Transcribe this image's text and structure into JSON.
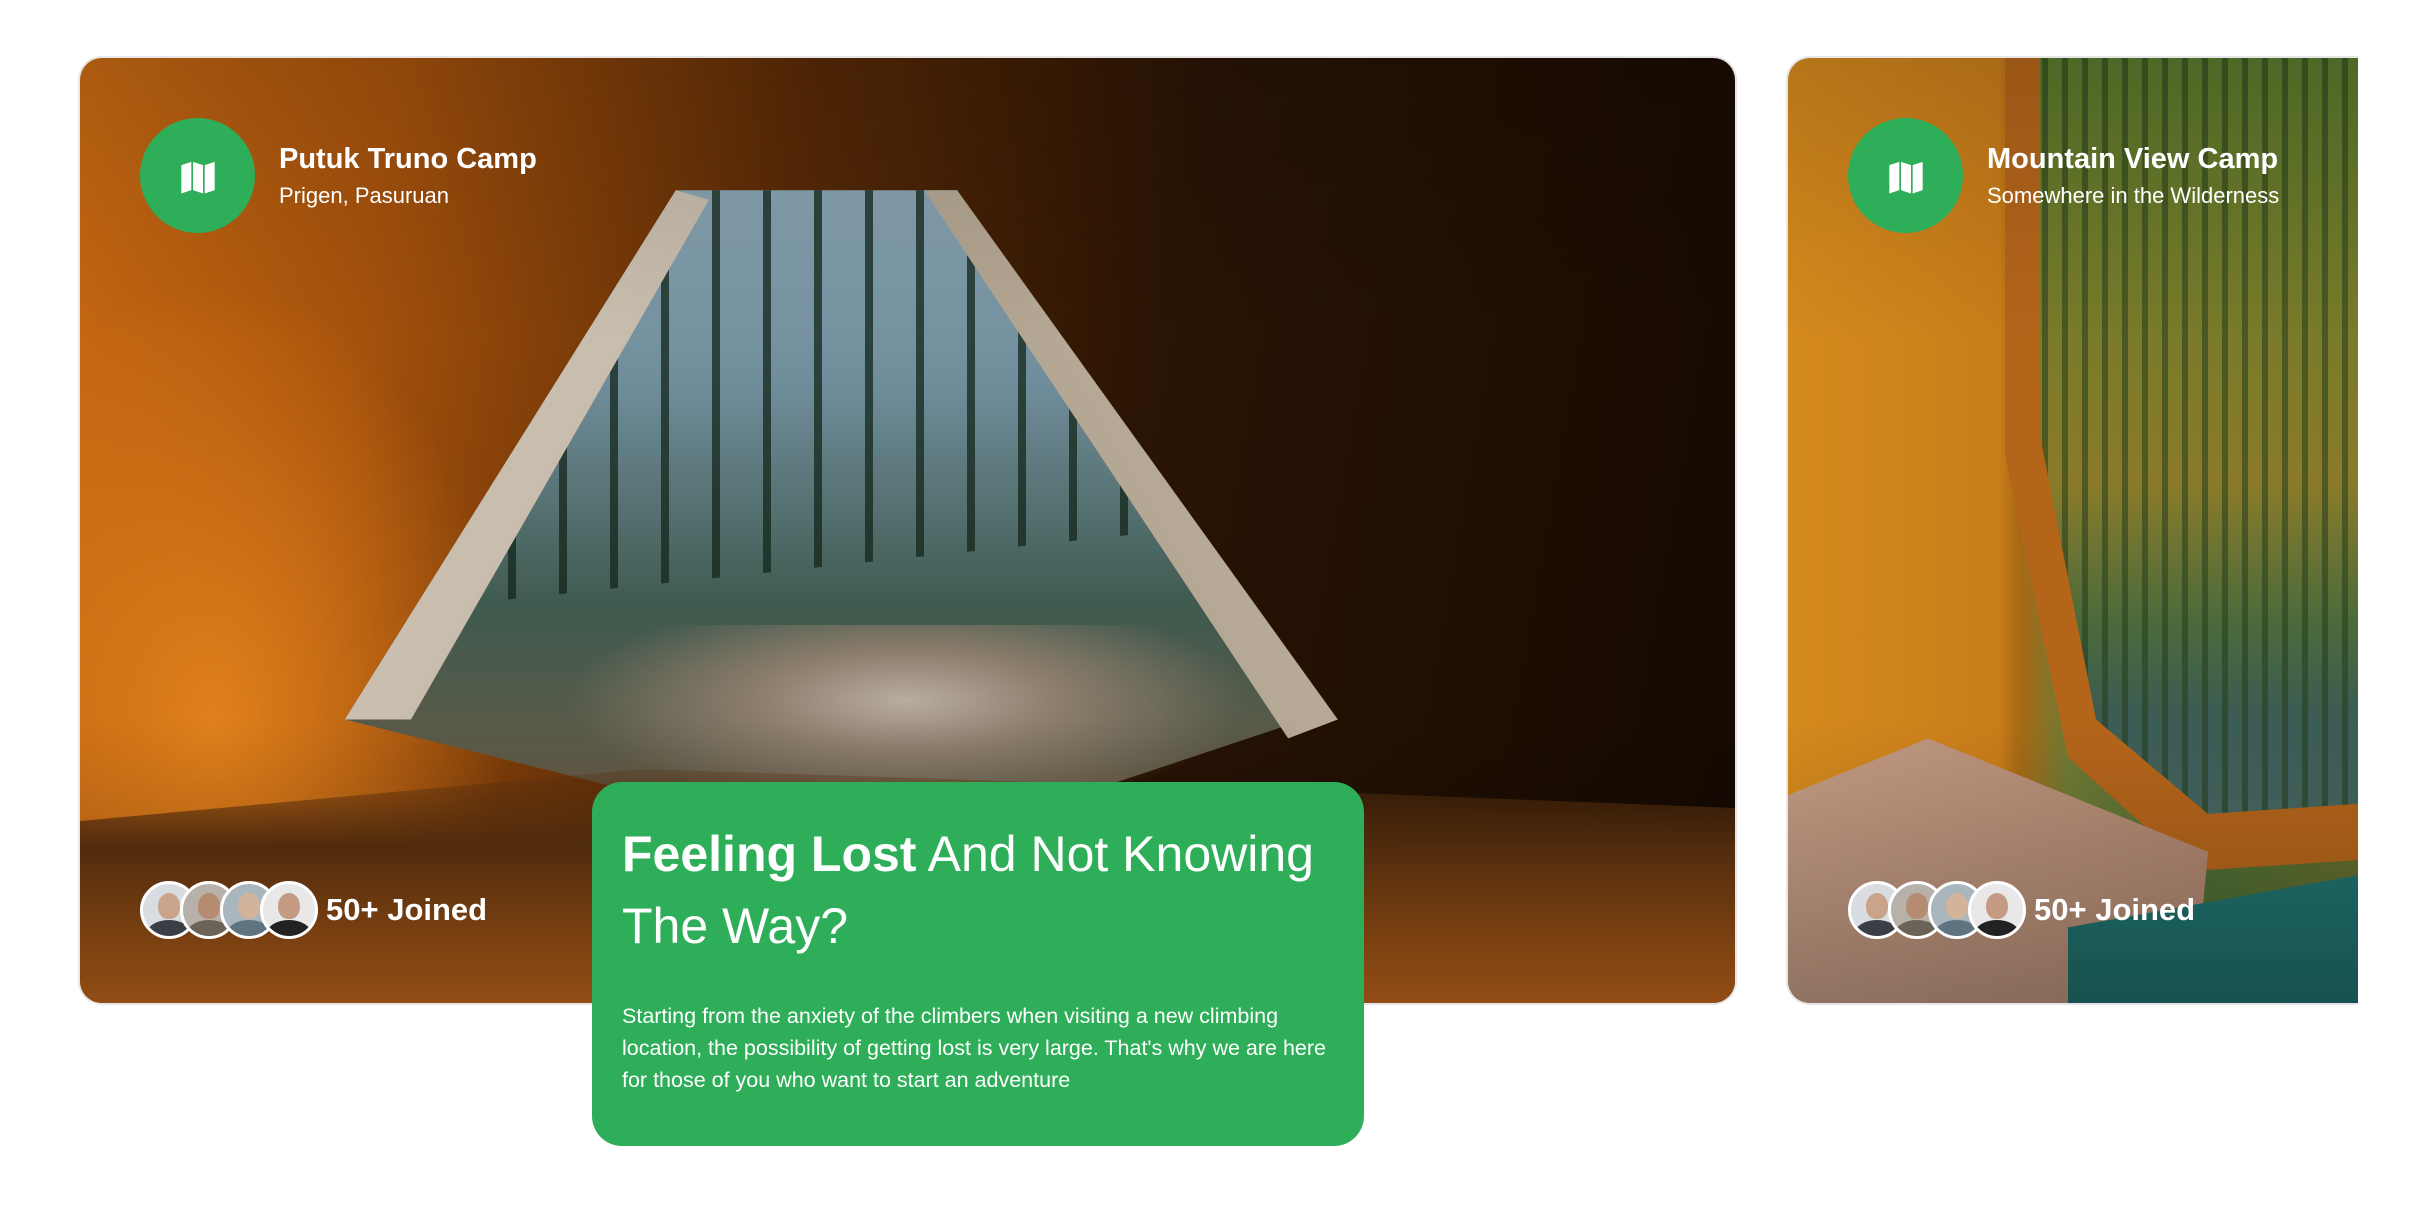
{
  "cards": [
    {
      "title": "Putuk Truno Camp",
      "location": "Prigen, Pasuruan",
      "joined": "50+ Joined",
      "icon": "map-icon"
    },
    {
      "title": "Mountain View Camp",
      "location": "Somewhere in the Wilderness",
      "joined": "50+ Joined",
      "icon": "map-icon"
    }
  ],
  "info": {
    "title_bold": "Feeling Lost",
    "title_rest": " And Not Knowing The Way?",
    "body": "Starting from the anxiety of the climbers when visiting a new climbing location, the possibility of getting lost is very large. That's why we are here for those of you who want to start an adventure"
  },
  "colors": {
    "accent": "#2eae58",
    "text_on_accent": "#ffffff"
  }
}
